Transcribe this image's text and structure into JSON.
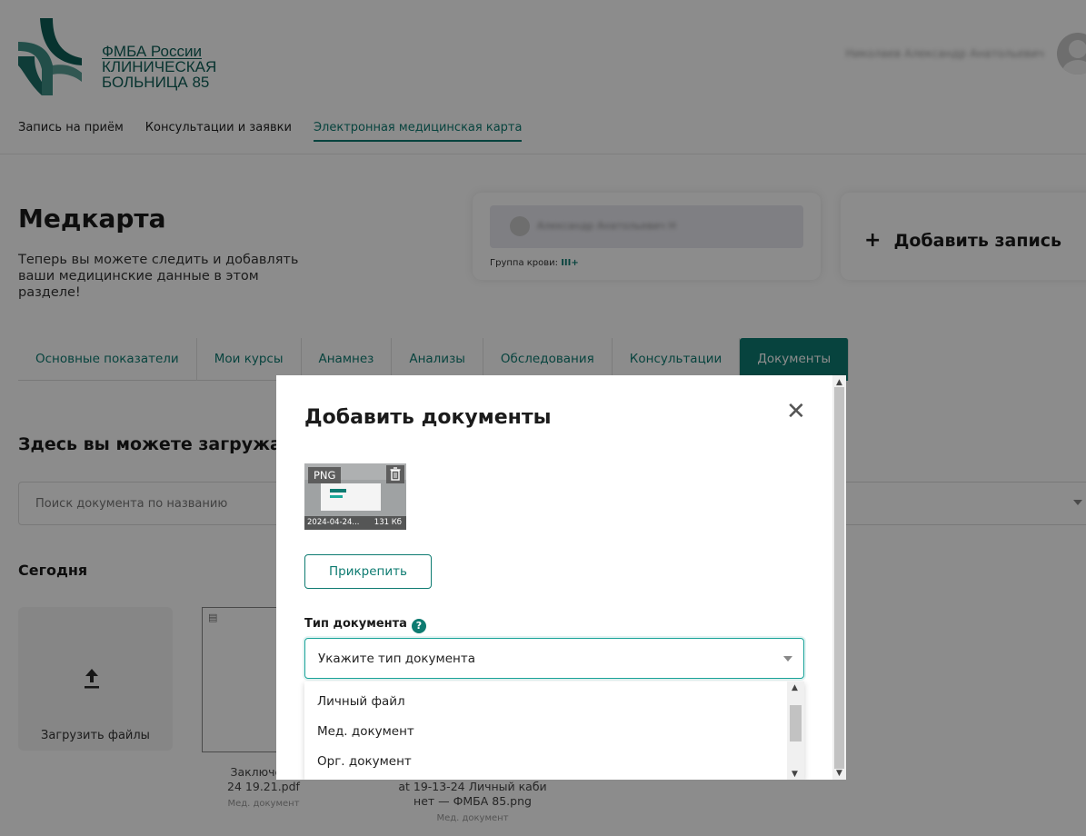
{
  "header": {
    "logo_lines": [
      "ФМБА России",
      "КЛИНИЧЕСКАЯ",
      "БОЛЬНИЦА 85"
    ],
    "user_name": "Николаев Александр Анатольевич",
    "nav": [
      "Запись на приём",
      "Консультации и заявки",
      "Электронная медицинская карта"
    ],
    "active_nav": "Электронная медицинская карта"
  },
  "page": {
    "title": "Медкарта",
    "subtitle": "Теперь вы можете следить и добавлять ваши медицинские данные в этом разделе!",
    "profile": {
      "name": "Александр Анатольевич Н",
      "blood_label": "Группа крови:",
      "blood_value": "III+"
    },
    "add_record_label": "Добавить запись",
    "tabs": [
      "Основные показатели",
      "Мои курсы",
      "Анамнез",
      "Анализы",
      "Обследования",
      "Консультации",
      "Документы"
    ],
    "active_tab": "Документы",
    "section_title": "Здесь вы можете загружат",
    "search_placeholder": "Поиск документа по названию",
    "day_title": "Сегодня",
    "upload_label": "Загрузить файлы",
    "documents": [
      {
        "name_line1": "Заключени",
        "name_line2": "24 19.21.pdf",
        "type": "Мед. документ"
      },
      {
        "name_line1": "at 19-13-24 Личный каби",
        "name_line2": "нет — ФМБА 85.png",
        "type": "Мед. документ"
      }
    ]
  },
  "modal": {
    "title": "Добавить документы",
    "close_icon": "close-icon",
    "attachment": {
      "badge": "PNG",
      "file_name": "2024-04-24...",
      "file_size": "131 Кб"
    },
    "attach_button": "Прикрепить",
    "type_label": "Тип документа",
    "help_glyph": "?",
    "select_placeholder": "Укажите тип документа",
    "options": [
      "Личный файл",
      "Мед. документ",
      "Орг. документ"
    ]
  },
  "colors": {
    "accent": "#0e7b71",
    "focus": "#1ba49a",
    "overlay": "rgba(0,0,0,0.45)"
  }
}
